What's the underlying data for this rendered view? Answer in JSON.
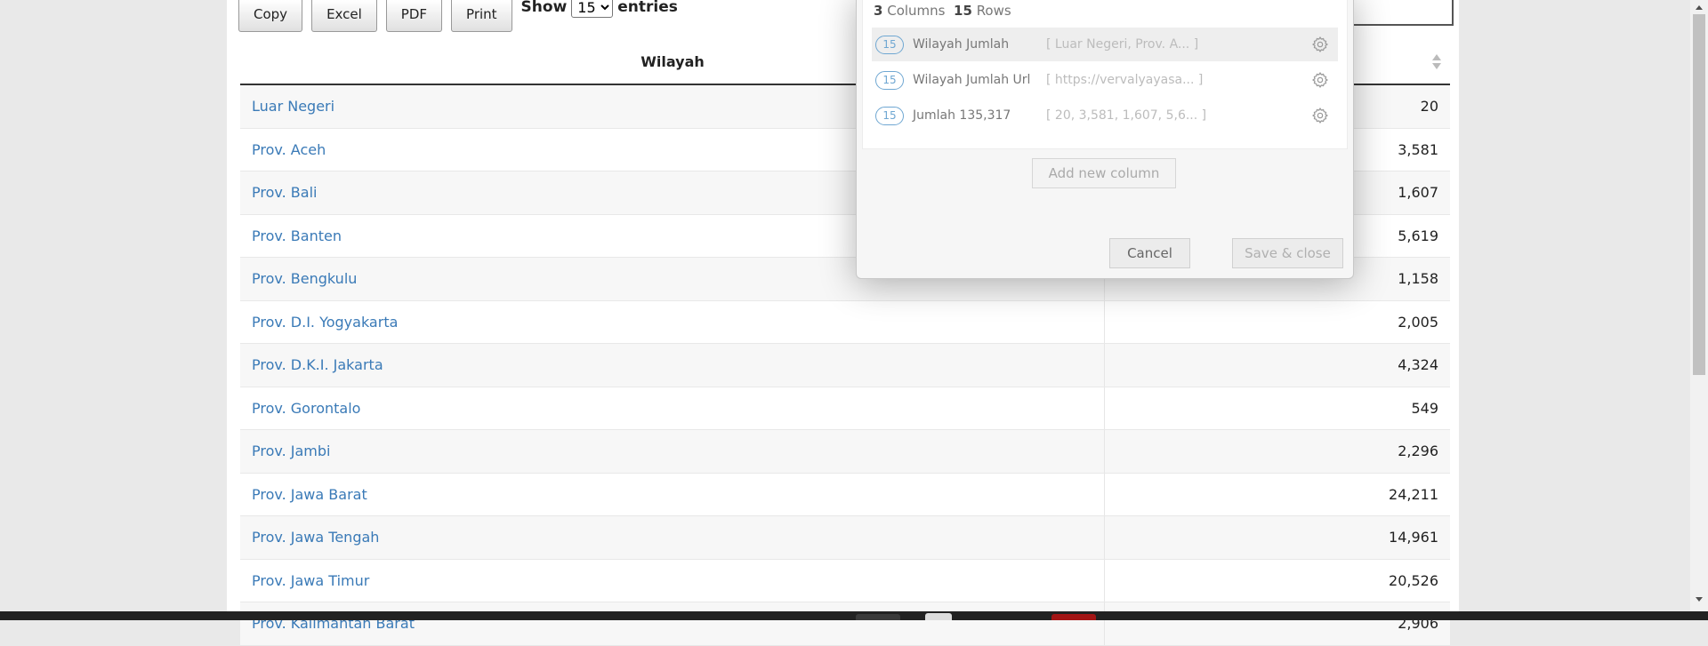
{
  "toolbar": {
    "buttons": [
      "Copy",
      "Excel",
      "PDF",
      "Print"
    ],
    "show_label": "Show",
    "entries_value": "15",
    "entries_label": "entries"
  },
  "table": {
    "columns": [
      "Wilayah",
      ""
    ],
    "rows": [
      {
        "wilayah": "Luar Negeri",
        "jumlah": "20"
      },
      {
        "wilayah": "Prov. Aceh",
        "jumlah": "3,581"
      },
      {
        "wilayah": "Prov. Bali",
        "jumlah": "1,607"
      },
      {
        "wilayah": "Prov. Banten",
        "jumlah": "5,619"
      },
      {
        "wilayah": "Prov. Bengkulu",
        "jumlah": "1,158"
      },
      {
        "wilayah": "Prov. D.I. Yogyakarta",
        "jumlah": "2,005"
      },
      {
        "wilayah": "Prov. D.K.I. Jakarta",
        "jumlah": "4,324"
      },
      {
        "wilayah": "Prov. Gorontalo",
        "jumlah": "549"
      },
      {
        "wilayah": "Prov. Jambi",
        "jumlah": "2,296"
      },
      {
        "wilayah": "Prov. Jawa Barat",
        "jumlah": "24,211"
      },
      {
        "wilayah": "Prov. Jawa Tengah",
        "jumlah": "14,961"
      },
      {
        "wilayah": "Prov. Jawa Timur",
        "jumlah": "20,526"
      },
      {
        "wilayah": "Prov. Kalimantan Barat",
        "jumlah": "2,906"
      }
    ]
  },
  "modal": {
    "columns_count": "3",
    "columns_label": "Columns",
    "rows_count": "15",
    "rows_label": "Rows",
    "columns": [
      {
        "count": "15",
        "name": "Wilayah Jumlah",
        "preview": "[ Luar Negeri, Prov. A... ]"
      },
      {
        "count": "15",
        "name": "Wilayah Jumlah Url",
        "preview": "[ https://vervalyayasa... ]"
      },
      {
        "count": "15",
        "name": "Jumlah 135,317",
        "preview": "[ 20, 3,581, 1,607, 5,6... ]"
      }
    ],
    "add_column_label": "Add new column",
    "cancel_label": "Cancel",
    "save_label": "Save & close"
  },
  "colors": {
    "link": "#3a7ab7",
    "badge": "#6fa7d2",
    "taskbar_red": "#a31515"
  }
}
